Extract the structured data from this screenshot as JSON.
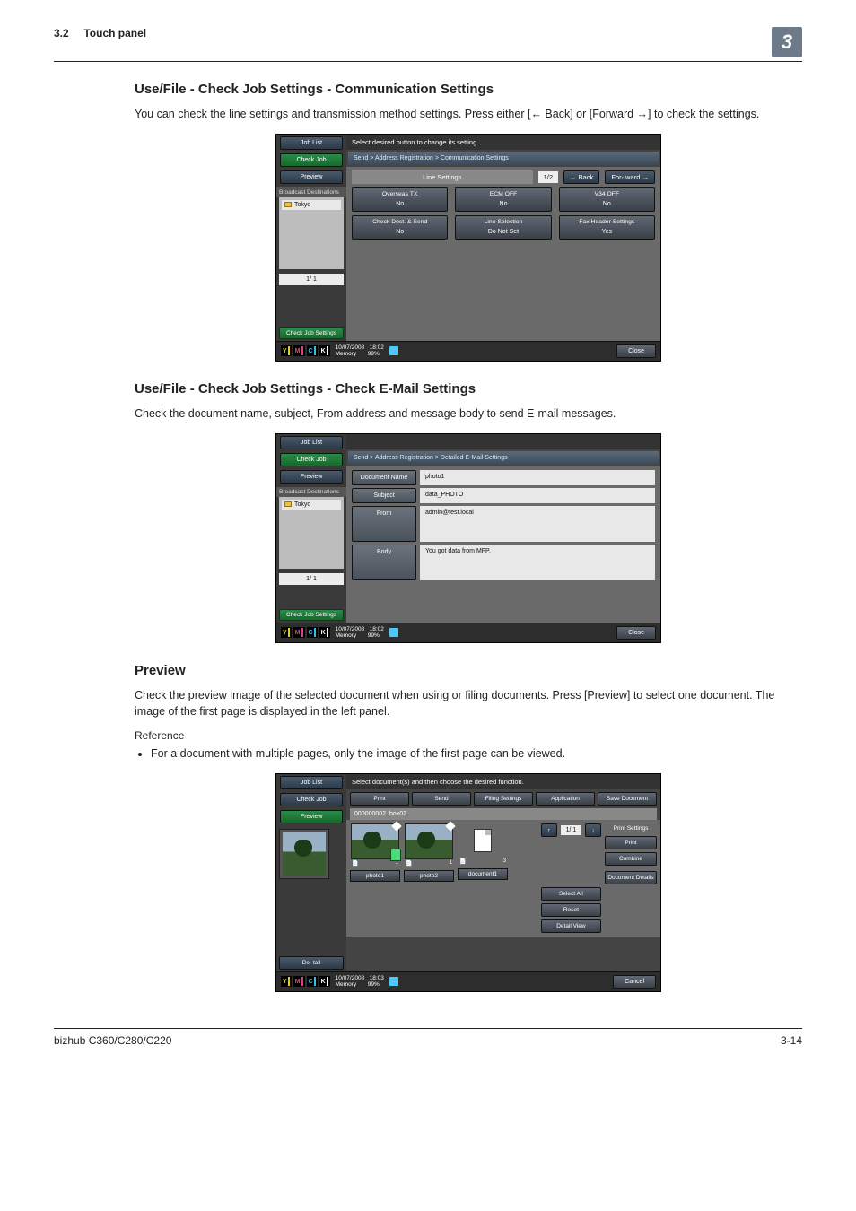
{
  "header": {
    "section_no": "3.2",
    "section_title": "Touch panel",
    "chapter_no": "3"
  },
  "sec1": {
    "title": "Use/File - Check Job Settings - Communication Settings",
    "para": "You can check the line settings and transmission method settings. Press either [← Back] or [Forward →] to check the settings."
  },
  "sec2": {
    "title": "Use/File - Check Job Settings - Check E-Mail Settings",
    "para": "Check the document name, subject, From address and message body to send E-mail messages."
  },
  "sec3": {
    "title": "Preview",
    "para": "Check the preview image of the selected document when using or filing documents. Press [Preview] to select one document. The image of the first page is displayed in the left panel.",
    "reference_label": "Reference",
    "bullet": "For a document with multiple pages, only the image of the first page can be viewed."
  },
  "panel_common": {
    "tabs": {
      "job_list": "Job List",
      "check_job": "Check Job",
      "preview": "Preview"
    },
    "broadcast": "Broadcast Destinations",
    "dest_tokyo": "Tokyo",
    "page_ind": "1/  1",
    "check_job_settings": "Check Job Settings",
    "detail": "De- tail",
    "date": "10/07/2008",
    "time": "18:02",
    "memory_label": "Memory",
    "memory_pct": "99%",
    "close": "Close",
    "cancel": "Cancel"
  },
  "panel1": {
    "instr": "Select desired button to change its setting.",
    "crumb": "Send > Address Registration > Communication Settings",
    "line_settings": "Line Settings",
    "page": "1/2",
    "back": "Back",
    "forward": "For- ward",
    "cells": {
      "c1": "Overseas TX",
      "c1v": "No",
      "c2": "ECM OFF",
      "c2v": "No",
      "c3": "V34 OFF",
      "c3v": "No",
      "c4": "Check Dest. & Send",
      "c4v": "No",
      "c5": "Line Selection",
      "c5v": "Do Not Set",
      "c6": "Fax Header Settings",
      "c6v": "Yes"
    }
  },
  "panel2": {
    "crumb": "Send > Address Registration > Detailed E-Mail Settings",
    "rows": {
      "docname_l": "Document Name",
      "docname_v": "photo1",
      "subject_l": "Subject",
      "subject_v": "data_PHOTO",
      "from_l": "From",
      "from_v": "admin@test.local",
      "body_l": "Body",
      "body_v": "You got data from MFP."
    }
  },
  "panel3": {
    "instr": "Select document(s) and then choose the desired function.",
    "tabs": {
      "print": "Print",
      "send": "Send",
      "filing": "Filing Settings",
      "application": "Application",
      "save": "Save Document"
    },
    "boxid": "000000002",
    "boxname": "box02",
    "thumbs": {
      "t1": "photo1",
      "t2": "photo2",
      "t3": "document1",
      "n1": "1",
      "n2": "1",
      "n3": "3"
    },
    "page": "1/  1",
    "side": {
      "print_settings": "Print Settings",
      "print": "Print",
      "combine": "Combine",
      "doc_details": "Document Details"
    },
    "sel": {
      "select_all": "Select All",
      "reset": "Reset",
      "detail_view": "Detail View"
    },
    "time": "18:03"
  },
  "footer": {
    "model": "bizhub C360/C280/C220",
    "page": "3-14"
  }
}
